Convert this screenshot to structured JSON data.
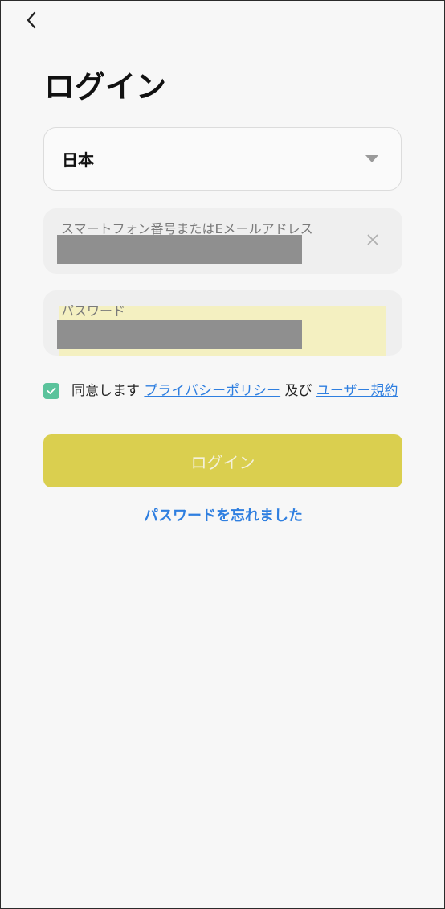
{
  "header": {
    "back_icon": "chevron-left-icon",
    "title": "ログイン"
  },
  "region": {
    "value": "日本",
    "icon": "triangle-down-icon"
  },
  "account_field": {
    "label": "スマートフォン番号またはEメールアドレス",
    "clear_icon": "close-icon"
  },
  "password_field": {
    "label": "パスワード"
  },
  "agreement": {
    "checked": true,
    "prefix": "同意します",
    "privacy_link": "プライバシーポリシー",
    "conjunction": "及び",
    "terms_link": "ユーザー規約"
  },
  "login_button": {
    "label": "ログイン"
  },
  "forgot_password": {
    "label": "パスワードを忘れました"
  },
  "colors": {
    "accent_button": "#dacf4f",
    "link": "#2f7fe0",
    "checkbox": "#5bc39c",
    "background": "#f7f7f7"
  }
}
